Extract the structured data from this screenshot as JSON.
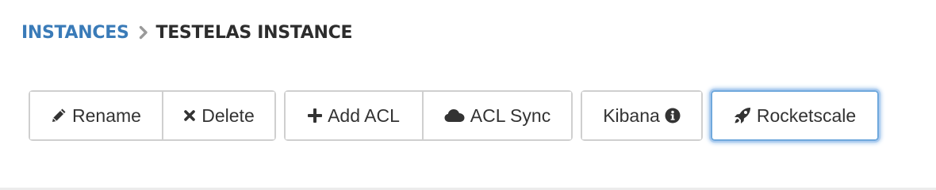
{
  "breadcrumb": {
    "parent": "INSTANCES",
    "current": "TESTELAS INSTANCE"
  },
  "toolbar": {
    "rename_label": "Rename",
    "delete_label": "Delete",
    "add_acl_label": "Add ACL",
    "acl_sync_label": "ACL Sync",
    "kibana_label": "Kibana",
    "rocketscale_label": "Rocketscale"
  },
  "icons": {
    "rename": "pencil-icon",
    "delete": "close-icon",
    "add_acl": "plus-icon",
    "acl_sync": "cloud-icon",
    "kibana": "info-icon",
    "rocketscale": "rocket-icon",
    "separator": "chevron-right-icon"
  },
  "colors": {
    "link": "#3a7bb8",
    "heading": "#2d2d2d",
    "button_text": "#333333",
    "button_border": "#cfcfcf",
    "focus_ring": "#6fa8dc"
  }
}
